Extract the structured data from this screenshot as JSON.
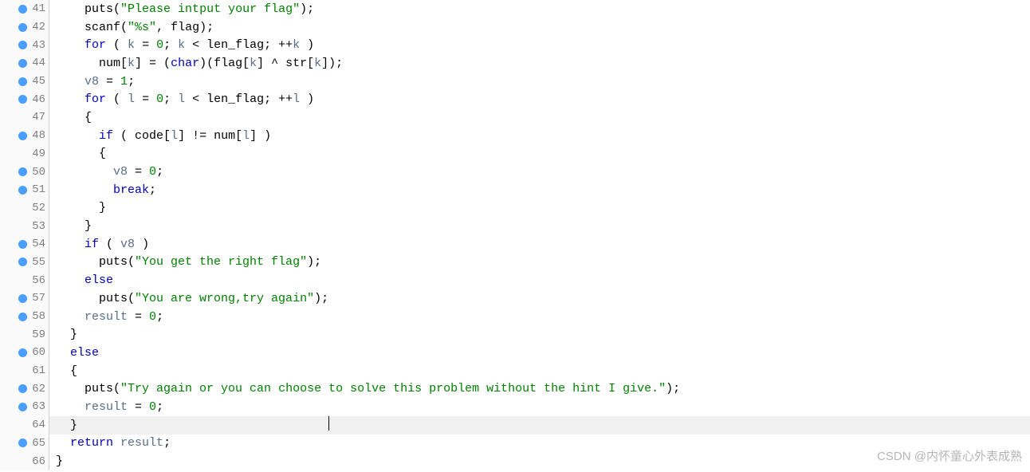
{
  "watermark": "CSDN @内怀童心外表成熟",
  "lines": [
    {
      "n": 41,
      "bp": true,
      "indent": 4,
      "tokens": [
        [
          "",
          "puts"
        ],
        [
          "pun",
          "("
        ],
        [
          "str",
          "\"Please intput your flag\""
        ],
        [
          "pun",
          ");"
        ]
      ]
    },
    {
      "n": 42,
      "bp": true,
      "indent": 4,
      "tokens": [
        [
          "",
          "scanf"
        ],
        [
          "pun",
          "("
        ],
        [
          "str",
          "\"%s\""
        ],
        [
          "pun",
          ", flag);"
        ]
      ]
    },
    {
      "n": 43,
      "bp": true,
      "indent": 4,
      "tokens": [
        [
          "kw",
          "for"
        ],
        [
          "",
          " ( "
        ],
        [
          "var",
          "k"
        ],
        [
          "",
          " = "
        ],
        [
          "num",
          "0"
        ],
        [
          "",
          "; "
        ],
        [
          "var",
          "k"
        ],
        [
          "",
          " < len_flag; ++"
        ],
        [
          "var",
          "k"
        ],
        [
          "",
          " )"
        ]
      ]
    },
    {
      "n": 44,
      "bp": true,
      "indent": 6,
      "tokens": [
        [
          "",
          "num["
        ],
        [
          "var",
          "k"
        ],
        [
          "",
          "] = ("
        ],
        [
          "kw",
          "char"
        ],
        [
          "",
          ")(flag["
        ],
        [
          "var",
          "k"
        ],
        [
          "",
          "] ^ str["
        ],
        [
          "var",
          "k"
        ],
        [
          "",
          "]);"
        ]
      ]
    },
    {
      "n": 45,
      "bp": true,
      "indent": 4,
      "tokens": [
        [
          "var",
          "v8"
        ],
        [
          "",
          " = "
        ],
        [
          "num",
          "1"
        ],
        [
          "",
          ";"
        ]
      ]
    },
    {
      "n": 46,
      "bp": true,
      "indent": 4,
      "tokens": [
        [
          "kw",
          "for"
        ],
        [
          "",
          " ( "
        ],
        [
          "var",
          "l"
        ],
        [
          "",
          " = "
        ],
        [
          "num",
          "0"
        ],
        [
          "",
          "; "
        ],
        [
          "var",
          "l"
        ],
        [
          "",
          " < len_flag; ++"
        ],
        [
          "var",
          "l"
        ],
        [
          "",
          " )"
        ]
      ]
    },
    {
      "n": 47,
      "bp": false,
      "indent": 4,
      "tokens": [
        [
          "",
          "{"
        ]
      ]
    },
    {
      "n": 48,
      "bp": true,
      "indent": 6,
      "tokens": [
        [
          "kw",
          "if"
        ],
        [
          "",
          " ( code["
        ],
        [
          "var",
          "l"
        ],
        [
          "",
          "] != num["
        ],
        [
          "var",
          "l"
        ],
        [
          "",
          "] )"
        ]
      ]
    },
    {
      "n": 49,
      "bp": false,
      "indent": 6,
      "tokens": [
        [
          "",
          "{"
        ]
      ]
    },
    {
      "n": 50,
      "bp": true,
      "indent": 8,
      "tokens": [
        [
          "var",
          "v8"
        ],
        [
          "",
          " = "
        ],
        [
          "num",
          "0"
        ],
        [
          "",
          ";"
        ]
      ]
    },
    {
      "n": 51,
      "bp": true,
      "indent": 8,
      "tokens": [
        [
          "kw",
          "break"
        ],
        [
          "",
          ";"
        ]
      ]
    },
    {
      "n": 52,
      "bp": false,
      "indent": 6,
      "tokens": [
        [
          "",
          "}"
        ]
      ]
    },
    {
      "n": 53,
      "bp": false,
      "indent": 4,
      "tokens": [
        [
          "",
          "}"
        ]
      ]
    },
    {
      "n": 54,
      "bp": true,
      "indent": 4,
      "tokens": [
        [
          "kw",
          "if"
        ],
        [
          "",
          " ( "
        ],
        [
          "var",
          "v8"
        ],
        [
          "",
          " )"
        ]
      ]
    },
    {
      "n": 55,
      "bp": true,
      "indent": 6,
      "tokens": [
        [
          "",
          "puts("
        ],
        [
          "str",
          "\"You get the right flag\""
        ],
        [
          "",
          ");"
        ]
      ]
    },
    {
      "n": 56,
      "bp": false,
      "indent": 4,
      "tokens": [
        [
          "kw",
          "else"
        ]
      ]
    },
    {
      "n": 57,
      "bp": true,
      "indent": 6,
      "tokens": [
        [
          "",
          "puts("
        ],
        [
          "str",
          "\"You are wrong,try again\""
        ],
        [
          "",
          ");"
        ]
      ]
    },
    {
      "n": 58,
      "bp": true,
      "indent": 4,
      "tokens": [
        [
          "var",
          "result"
        ],
        [
          "",
          " = "
        ],
        [
          "num",
          "0"
        ],
        [
          "",
          ";"
        ]
      ]
    },
    {
      "n": 59,
      "bp": false,
      "indent": 2,
      "tokens": [
        [
          "",
          "}"
        ]
      ]
    },
    {
      "n": 60,
      "bp": true,
      "indent": 2,
      "tokens": [
        [
          "kw",
          "else"
        ]
      ]
    },
    {
      "n": 61,
      "bp": false,
      "indent": 2,
      "tokens": [
        [
          "",
          "{"
        ]
      ]
    },
    {
      "n": 62,
      "bp": true,
      "indent": 4,
      "tokens": [
        [
          "",
          "puts("
        ],
        [
          "str",
          "\"Try again or you can choose to solve this problem without the hint I give.\""
        ],
        [
          "",
          ");"
        ]
      ]
    },
    {
      "n": 63,
      "bp": true,
      "indent": 4,
      "tokens": [
        [
          "var",
          "result"
        ],
        [
          "",
          " = "
        ],
        [
          "num",
          "0"
        ],
        [
          "",
          ";"
        ]
      ]
    },
    {
      "n": 64,
      "bp": false,
      "indent": 2,
      "tokens": [
        [
          "",
          "}"
        ]
      ],
      "current": true,
      "cursorAt": 38
    },
    {
      "n": 65,
      "bp": true,
      "indent": 2,
      "tokens": [
        [
          "kw",
          "return"
        ],
        [
          "",
          " "
        ],
        [
          "var",
          "result"
        ],
        [
          "",
          ";"
        ]
      ]
    },
    {
      "n": 66,
      "bp": false,
      "indent": 0,
      "tokens": [
        [
          "",
          "}"
        ]
      ]
    }
  ]
}
